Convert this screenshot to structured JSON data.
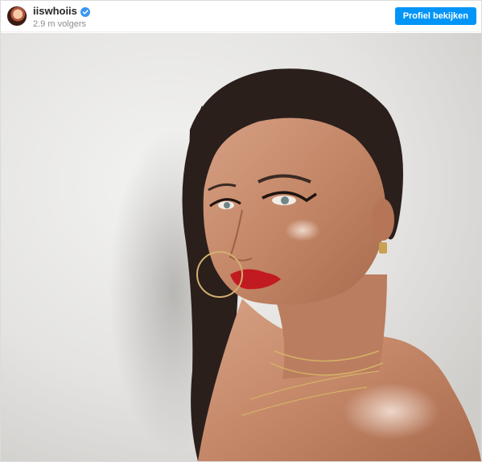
{
  "header": {
    "username": "iiswhoiis",
    "verified_icon": "verified-badge-icon",
    "followers": "2.9 m volgers",
    "profile_button": "Profiel bekijken"
  },
  "photo": {
    "subject_icon": "portrait-photo",
    "colors": {
      "background": "#e7e6e4",
      "hair": "#2a1f1b",
      "skin": "#c98f72",
      "lips": "#c21a21",
      "button": "#0095f6"
    }
  }
}
